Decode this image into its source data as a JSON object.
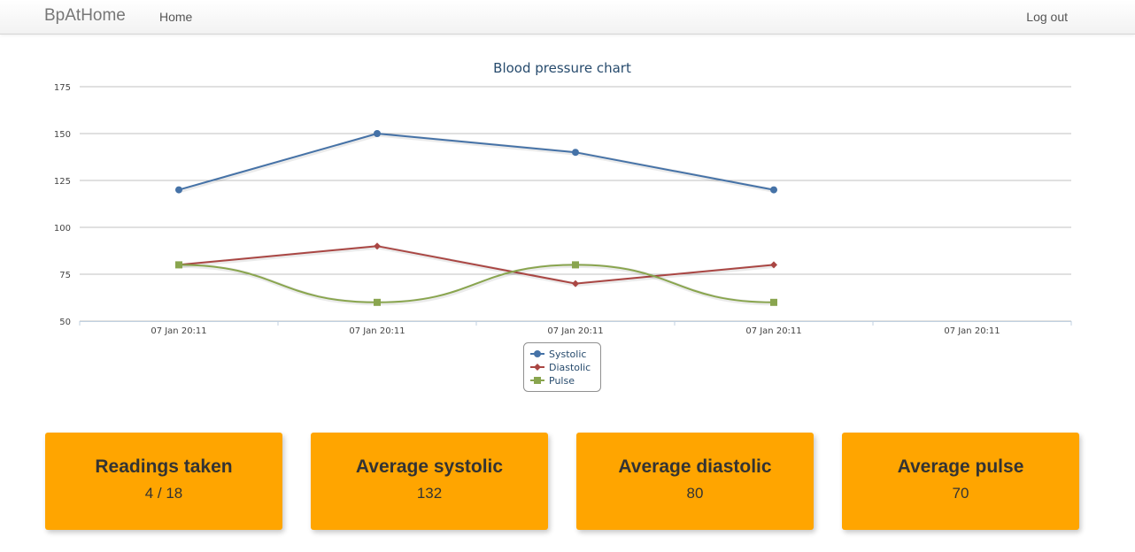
{
  "navbar": {
    "brand": "BpAtHome",
    "home": "Home",
    "logout": "Log out"
  },
  "colors": {
    "systolic": "#4572A7",
    "diastolic": "#AA4643",
    "pulse": "#89A54E",
    "stat_bg": "#FFA500"
  },
  "chart_data": {
    "type": "line",
    "title": "Blood pressure chart",
    "categories": [
      "07 Jan 20:11",
      "07 Jan 20:11",
      "07 Jan 20:11",
      "07 Jan 20:11",
      "07 Jan 20:11"
    ],
    "ylim": [
      50,
      175
    ],
    "yticks": [
      50,
      75,
      100,
      125,
      150,
      175
    ],
    "grid": true,
    "legend_position": "bottom-center",
    "series": [
      {
        "name": "Systolic",
        "values": [
          120,
          150,
          140,
          120
        ],
        "marker": "circle",
        "color": "#4572A7",
        "smooth": false
      },
      {
        "name": "Diastolic",
        "values": [
          80,
          90,
          70,
          80
        ],
        "marker": "diamond",
        "color": "#AA4643",
        "smooth": false
      },
      {
        "name": "Pulse",
        "values": [
          80,
          60,
          80,
          60
        ],
        "marker": "square",
        "color": "#89A54E",
        "smooth": true
      }
    ]
  },
  "stats": [
    {
      "title": "Readings taken",
      "value": "4 / 18"
    },
    {
      "title": "Average systolic",
      "value": "132"
    },
    {
      "title": "Average diastolic",
      "value": "80"
    },
    {
      "title": "Average pulse",
      "value": "70"
    }
  ]
}
